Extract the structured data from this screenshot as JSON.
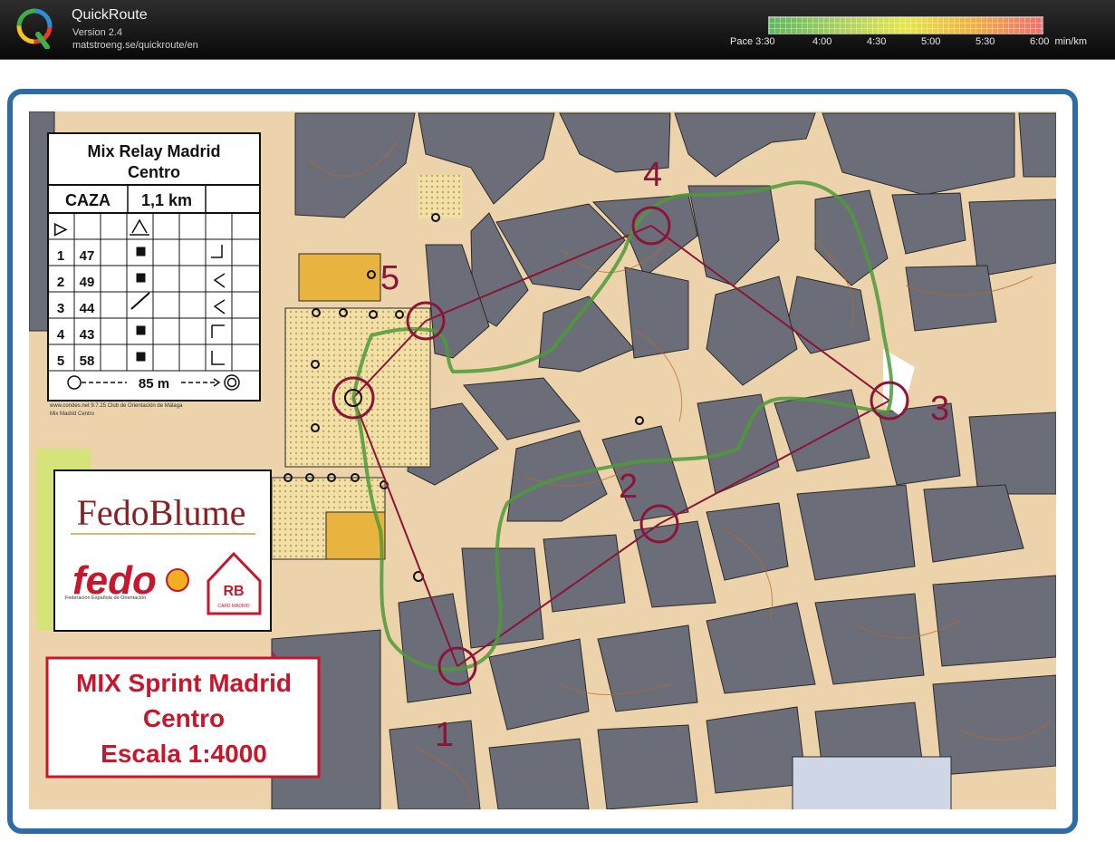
{
  "app": {
    "name": "QuickRoute",
    "version": "Version 2.4",
    "url": "matstroeng.se/quickroute/en",
    "logo_letter": "Q"
  },
  "pace_legend": {
    "label": "Pace",
    "ticks": [
      "3:30",
      "4:00",
      "4:30",
      "5:00",
      "5:30",
      "6:00"
    ],
    "unit": "min/km",
    "colors": [
      "#5cb85c",
      "#a8d060",
      "#e6e64a",
      "#f0b040",
      "#ef7070"
    ]
  },
  "control_card": {
    "title_line1": "Mix Relay Madrid",
    "title_line2": "Centro",
    "category": "CAZA",
    "distance": "1,1 km",
    "start_symbol": "▷",
    "rows": [
      {
        "num": "1",
        "code": "47"
      },
      {
        "num": "2",
        "code": "49"
      },
      {
        "num": "3",
        "code": "44"
      },
      {
        "num": "4",
        "code": "43"
      },
      {
        "num": "5",
        "code": "58"
      }
    ],
    "finish_distance": "85 m",
    "footer_line1": "www.condes.net 9.7.25 Club de Orientación de Málaga",
    "footer_line2": "Mix Madrid Centro"
  },
  "sponsor": {
    "name": "FedoBlume",
    "fedo_text": "fedo",
    "fedo_subtitle": "Federación Española de Orientación",
    "badge_letters": "RB",
    "badge_subtitle": "CARD MADRID"
  },
  "event": {
    "line1": "MIX Sprint Madrid",
    "line2": "Centro",
    "line3": "Escala 1:4000"
  },
  "controls": [
    {
      "label": "1"
    },
    {
      "label": "2"
    },
    {
      "label": "3"
    },
    {
      "label": "4"
    },
    {
      "label": "5"
    }
  ],
  "colors": {
    "topbar": "#111111",
    "frame_blue": "#2d6ca7",
    "course_purple": "#8b1538",
    "route_green": "#4e9a3a",
    "building_gray": "#6b6e78",
    "street_tan": "#ecd3ac",
    "contour_brown": "#b8672a",
    "event_red": "#c8162c"
  }
}
